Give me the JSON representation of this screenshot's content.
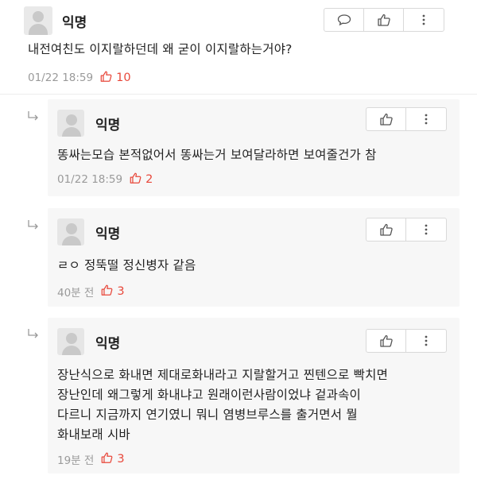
{
  "post": {
    "author": "익명",
    "text": "내전여친도 이지랄하던데 왜 굳이 이지랄하는거야?",
    "time": "01/22 18:59",
    "likes": "10",
    "icons": [
      "comment-icon",
      "thumbs-up-icon",
      "more-vertical-icon"
    ]
  },
  "comments": [
    {
      "author": "익명",
      "text": "똥싸는모습 본적없어서 똥싸는거 보여달라하면 보여줄건가 참",
      "time": "01/22 18:59",
      "likes": "2"
    },
    {
      "author": "익명",
      "text": "ㄹㅇ 정뚝떨 정신병자 같음",
      "time": "40분 전",
      "likes": "3"
    },
    {
      "author": "익명",
      "lines": [
        "장난식으로 화내면 제대로화내라고 지랄할거고 찐텐으로 빡치면",
        "장난인데 왜그렇게 화내냐고 원래이런사람이었냐 겉과속이",
        "다르니 지금까지 연기였니 뭐니 염병브루스를 출거면서 뭘",
        "화내보래 시바"
      ],
      "time": "19분 전",
      "likes": "3"
    }
  ],
  "colors": {
    "like": "#e8483b",
    "meta": "#9a9a9a",
    "comment_bg": "#f7f7f7",
    "border": "#d9d9d9"
  }
}
